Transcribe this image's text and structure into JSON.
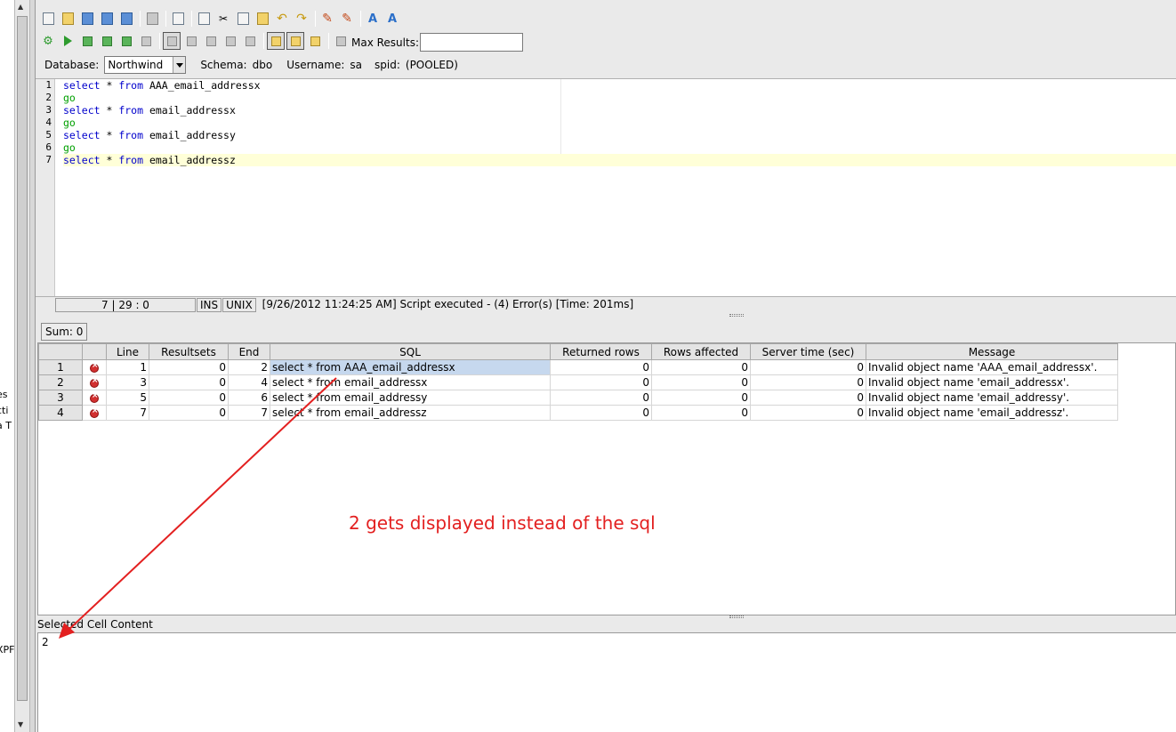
{
  "toolbar": {
    "max_results_label": "Max Results:",
    "max_results_value": ""
  },
  "session": {
    "database_label": "Database:",
    "database_value": "Northwind",
    "schema_label": "Schema:",
    "schema_value": "dbo",
    "username_label": "Username:",
    "username_value": "sa",
    "spid_label": "spid:",
    "spid_value": "(POOLED)"
  },
  "editor": {
    "line_numbers": [
      "1",
      "2",
      "3",
      "4",
      "5",
      "6",
      "7"
    ],
    "lines": [
      {
        "kw": "select",
        "star": " * ",
        "from": "from",
        "rest": " AAA_email_addressx"
      },
      {
        "go": "go"
      },
      {
        "kw": "select",
        "star": " * ",
        "from": "from",
        "rest": " email_addressx"
      },
      {
        "go": "go"
      },
      {
        "kw": "select",
        "star": " * ",
        "from": "from",
        "rest": " email_addressy"
      },
      {
        "go": "go"
      },
      {
        "kw": "select",
        "star": " * ",
        "from": "from",
        "rest": " email_addressz"
      }
    ]
  },
  "status": {
    "position": "7 | 29 : 0",
    "mode": "INS",
    "line_ending": "UNIX",
    "message": "[9/26/2012 11:24:25 AM] Script executed - (4) Error(s) [Time: 201ms]"
  },
  "results": {
    "sum_label": "Sum: 0",
    "columns": [
      "Line",
      "Resultsets",
      "End",
      "SQL",
      "Returned rows",
      "Rows affected",
      "Server time (sec)",
      "Message"
    ],
    "rows": [
      {
        "row": "1",
        "line": "1",
        "resultsets": "0",
        "end": "2",
        "sql": "select * from AAA_email_addressx",
        "returned": "0",
        "affected": "0",
        "server_time": "0",
        "message": "Invalid object name 'AAA_email_addressx'."
      },
      {
        "row": "2",
        "line": "3",
        "resultsets": "0",
        "end": "4",
        "sql": "select * from email_addressx",
        "returned": "0",
        "affected": "0",
        "server_time": "0",
        "message": "Invalid object name 'email_addressx'."
      },
      {
        "row": "3",
        "line": "5",
        "resultsets": "0",
        "end": "6",
        "sql": "select * from email_addressy",
        "returned": "0",
        "affected": "0",
        "server_time": "0",
        "message": "Invalid object name 'email_addressy'."
      },
      {
        "row": "4",
        "line": "7",
        "resultsets": "0",
        "end": "7",
        "sql": "select * from email_addressz",
        "returned": "0",
        "affected": "0",
        "server_time": "0",
        "message": "Invalid object name 'email_addressz'."
      }
    ]
  },
  "annotation": {
    "text": "2 gets displayed instead of the sql",
    "color": "#e32020"
  },
  "selected_cell": {
    "label": "Selected Cell Content",
    "value": "2"
  },
  "left_fragments": [
    "es",
    "cti",
    "a T",
    "XPF"
  ]
}
